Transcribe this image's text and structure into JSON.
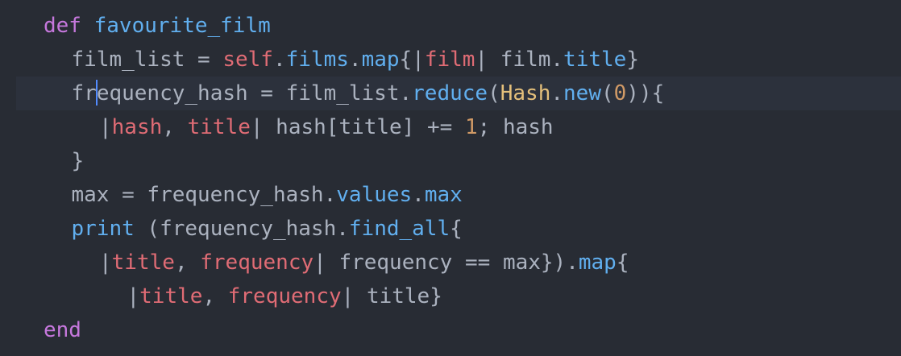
{
  "editor": {
    "theme": "one-dark",
    "colors": {
      "background": "#282c34",
      "active_line": "#2c313c",
      "cursor": "#528bff",
      "keyword": "#c678dd",
      "function": "#61afef",
      "variable": "#e06c75",
      "constant": "#e5c07b",
      "number": "#d19a66",
      "plain": "#abb2bf",
      "punctuation": "#abb2bf"
    },
    "cursor": {
      "line": 3,
      "column": 2
    },
    "lines": [
      {
        "indent": 0,
        "tokens": [
          {
            "t": "def",
            "k": "keyword"
          },
          {
            "t": " ",
            "k": "plain"
          },
          {
            "t": "favourite_film",
            "k": "function"
          }
        ]
      },
      {
        "indent": 1,
        "tokens": [
          {
            "t": "film_list = ",
            "k": "plain"
          },
          {
            "t": "self",
            "k": "variable"
          },
          {
            "t": ".",
            "k": "plain"
          },
          {
            "t": "films",
            "k": "function"
          },
          {
            "t": ".",
            "k": "plain"
          },
          {
            "t": "map",
            "k": "function"
          },
          {
            "t": "{|",
            "k": "plain"
          },
          {
            "t": "film",
            "k": "variable"
          },
          {
            "t": "| film.",
            "k": "plain"
          },
          {
            "t": "title",
            "k": "function"
          },
          {
            "t": "}",
            "k": "plain"
          }
        ]
      },
      {
        "indent": 1,
        "active": true,
        "tokens": [
          {
            "t": "fr",
            "k": "plain"
          },
          {
            "t": "equency_hash = film_list.",
            "k": "plain"
          },
          {
            "t": "reduce",
            "k": "function"
          },
          {
            "t": "(",
            "k": "plain"
          },
          {
            "t": "Hash",
            "k": "constant"
          },
          {
            "t": ".",
            "k": "plain"
          },
          {
            "t": "new",
            "k": "function"
          },
          {
            "t": "(",
            "k": "plain"
          },
          {
            "t": "0",
            "k": "number"
          },
          {
            "t": ")){",
            "k": "plain"
          }
        ]
      },
      {
        "indent": 2,
        "tokens": [
          {
            "t": "|",
            "k": "plain"
          },
          {
            "t": "hash",
            "k": "variable"
          },
          {
            "t": ", ",
            "k": "plain"
          },
          {
            "t": "title",
            "k": "variable"
          },
          {
            "t": "| hash[title] += ",
            "k": "plain"
          },
          {
            "t": "1",
            "k": "number"
          },
          {
            "t": "; hash",
            "k": "plain"
          }
        ]
      },
      {
        "indent": 1,
        "tokens": [
          {
            "t": "}",
            "k": "plain"
          }
        ]
      },
      {
        "indent": 1,
        "tokens": [
          {
            "t": "max = frequency_hash.",
            "k": "plain"
          },
          {
            "t": "values",
            "k": "function"
          },
          {
            "t": ".",
            "k": "plain"
          },
          {
            "t": "max",
            "k": "function"
          }
        ]
      },
      {
        "indent": 1,
        "tokens": [
          {
            "t": "print",
            "k": "function"
          },
          {
            "t": " (frequency_hash.",
            "k": "plain"
          },
          {
            "t": "find_all",
            "k": "function"
          },
          {
            "t": "{",
            "k": "plain"
          }
        ]
      },
      {
        "indent": 2,
        "tokens": [
          {
            "t": "|",
            "k": "plain"
          },
          {
            "t": "title",
            "k": "variable"
          },
          {
            "t": ", ",
            "k": "plain"
          },
          {
            "t": "frequency",
            "k": "variable"
          },
          {
            "t": "| frequency == max}).",
            "k": "plain"
          },
          {
            "t": "map",
            "k": "function"
          },
          {
            "t": "{",
            "k": "plain"
          }
        ]
      },
      {
        "indent": 3,
        "tokens": [
          {
            "t": "|",
            "k": "plain"
          },
          {
            "t": "title",
            "k": "variable"
          },
          {
            "t": ", ",
            "k": "plain"
          },
          {
            "t": "frequency",
            "k": "variable"
          },
          {
            "t": "| title}",
            "k": "plain"
          }
        ]
      },
      {
        "indent": 0,
        "tokens": [
          {
            "t": "end",
            "k": "keyword"
          }
        ]
      }
    ]
  }
}
